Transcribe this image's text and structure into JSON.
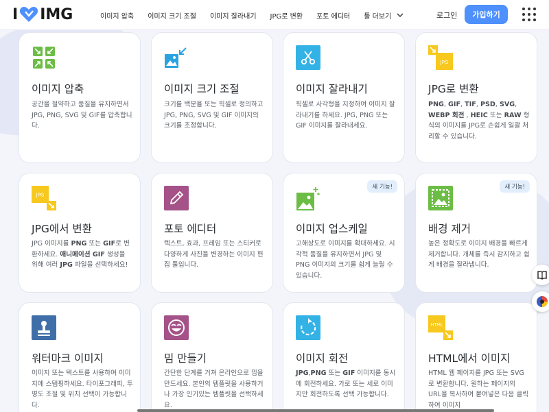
{
  "header": {
    "logo_i": "I",
    "logo_img": "IMG",
    "nav": [
      {
        "label": "이미지 압축"
      },
      {
        "label": "이미지 크기 조절"
      },
      {
        "label": "이미지 잘라내기"
      },
      {
        "label": "JPG로 변환"
      },
      {
        "label": "포토 에디터"
      },
      {
        "label": "툴 더보기"
      }
    ],
    "login": "로그인",
    "signup": "가입하기"
  },
  "colors": {
    "accent": "#4d90fe",
    "compress": "#6cbd45",
    "resize": "#2ba3e0",
    "crop": "#33b2e5",
    "jpg": "#f7c81e",
    "editor": "#a55288",
    "watermark": "#3f6ea8",
    "meme": "#a55288",
    "badge_bg": "#e3eefc"
  },
  "cards": [
    {
      "icon": "compress-icon",
      "title": "이미지 압축",
      "desc": "공간을 절약하고 품질을 유지하면서 JPG, PNG, SVG 및 GIF를 압축합니다."
    },
    {
      "icon": "resize-icon",
      "title": "이미지 크기 조절",
      "desc": "크기를 백분율 또는 픽셀로 정의하고 JPG, PNG, SVG 및 GIF 이미지의 크기를 조정합니다."
    },
    {
      "icon": "crop-icon",
      "title": "이미지 잘라내기",
      "desc": "픽셀로 사각형을 지정하여 이미지 잘라내기를 하세요. JPG, PNG 또는 GIF 이미지를 잘라내세요."
    },
    {
      "icon": "convert-to-jpg-icon",
      "icon_text": "JPG",
      "title": "JPG로 변환",
      "desc": "PNG, GIF, TIF, PSD, SVG, WEBP 회전 , HEIC 또는 RAW 형식의 이미지를 JPG로 손쉽게 일괄 처리할 수 있습니다."
    },
    {
      "icon": "convert-from-jpg-icon",
      "icon_text": "JPG",
      "title": "JPG에서 변환",
      "desc": "JPG 이미지를 PNG 또는 GIF로 변환하세요. 애니메이션 GIF 생성을 위해 여러 JPG 파일을 선택하세요!"
    },
    {
      "icon": "photo-editor-icon",
      "title": "포토 에디터",
      "desc": "텍스트, 효과, 프레임 또는 스티커로 다양하게 사진을 변경하는 이미지 편집 툴입니다."
    },
    {
      "icon": "upscale-icon",
      "title": "이미지 업스케일",
      "badge": "새 기능!",
      "desc": "고해상도로 이미지를 확대하세요. 시각적 품질을 유지하면서 JPG 및 PNG 이미지의 크기를 쉽게 늘릴 수 있습니다."
    },
    {
      "icon": "remove-background-icon",
      "title": "배경 제거",
      "badge": "새 기능!",
      "desc": "높은 정확도로 이미지 배경을 빠르게 제거합니다. 개체를 즉시 감지하고 쉽게 배경을 잘라냅니다."
    },
    {
      "icon": "watermark-icon",
      "title": "워터마크 이미지",
      "desc": "이미지 또는 텍스트를 사용하여 이미지에 스탬핑하세요. 타이포그래피, 투명도 조절 및 위치 선택이 가능합니다."
    },
    {
      "icon": "meme-icon",
      "title": "밈 만들기",
      "desc": "간단한 단계를 거쳐 온라인으로 밈을 만드세요. 본인의 템플릿을 사용하거나 가장 인기있는 템플릿을 선택하세요."
    },
    {
      "icon": "rotate-icon",
      "title": "이미지 회전",
      "desc": "JPG,PNG 또는 GIF 이미지를 동시에 회전하세요. 가로 또는 세로 이미지만 회전하도록 선택 가능합니다."
    },
    {
      "icon": "html-to-image-icon",
      "icon_text": "HTML",
      "title": "HTML에서 이미지",
      "desc": "HTML 웹 페이지를 JPG 또는 SVG로 변환합니다. 원하는 페이지의 URL을 복사하여 붙여넣은 다음 클릭하여 이미지"
    }
  ]
}
